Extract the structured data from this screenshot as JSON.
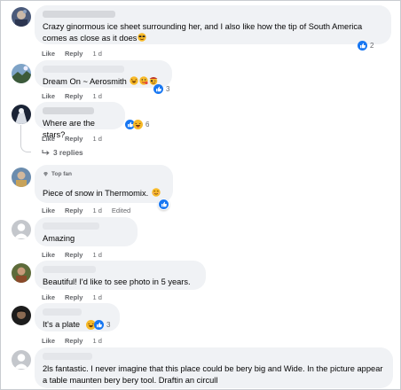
{
  "actions": {
    "like": "Like",
    "reply": "Reply"
  },
  "comments": [
    {
      "text": "Crazy ginormous ice sheet surrounding her, and I also like how the tip of South America comes as close as it does",
      "text_emoji": "sunglasses-face",
      "reactions": [
        "like"
      ],
      "reaction_count": "2",
      "time": "1 d"
    },
    {
      "text": "Dream On ~ Aerosmith",
      "text_emojis": [
        "laughing-face",
        "rock-face",
        "pirate-face"
      ],
      "reactions": [
        "like"
      ],
      "reaction_count": "3",
      "time": "1 d"
    },
    {
      "text": "Where are the stars?",
      "reactions": [
        "like",
        "haha"
      ],
      "reaction_count": "6",
      "time": "1 d",
      "replies_label": "3 replies"
    },
    {
      "badge": "Top fan",
      "text": "Piece of snow in Thermomix.",
      "text_emoji": "smiling-face",
      "reactions": [
        "like"
      ],
      "time": "1 d",
      "edited": "Edited"
    },
    {
      "text": "Amazing",
      "time": "1 d"
    },
    {
      "text": "Beautiful! I'd like to see photo in 5 years.",
      "time": "1 d"
    },
    {
      "text": "It's a plate",
      "reactions": [
        "haha",
        "like"
      ],
      "reaction_count": "3",
      "time": "1 d"
    },
    {
      "text": "2ls fantastic. I never imagine that this place could be bery big and Wide. In the picture appear a table maunten bery bery tool. Draftin an circull"
    }
  ],
  "colors": {
    "like_blue": "#1877f2",
    "haha_yellow": "#f7b928",
    "bubble_gray": "#f0f2f5",
    "meta_gray": "#65676b"
  }
}
